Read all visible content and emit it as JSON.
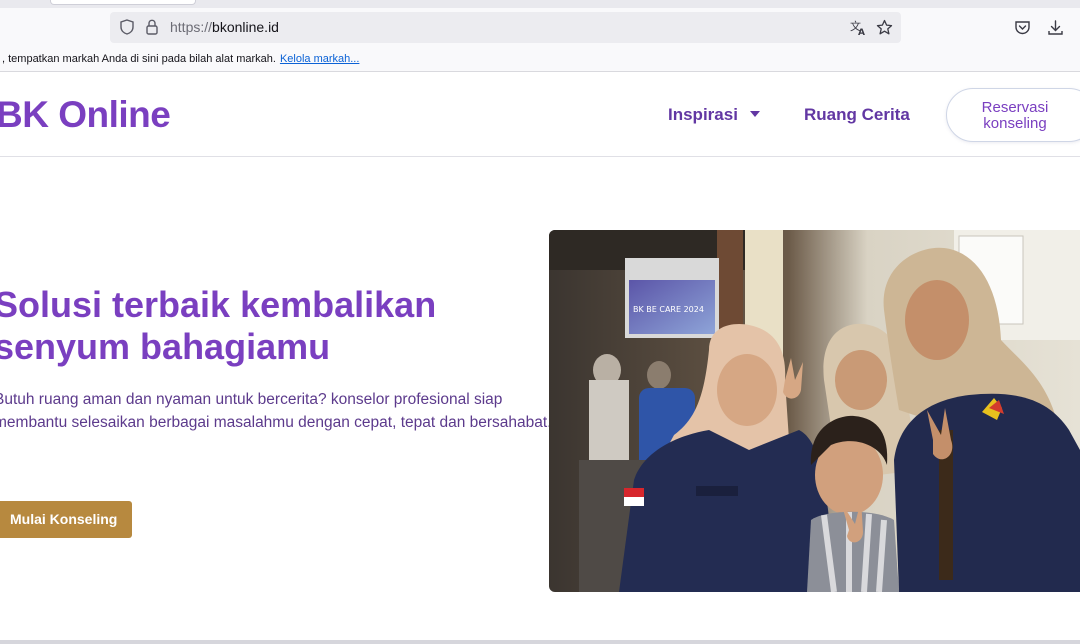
{
  "browser": {
    "url_protocol": "https://",
    "url_host": "bkonline.id",
    "bookmarks_text": ", tempatkan markah Anda di sini pada bilah alat markah.",
    "bookmarks_link": "Kelola markah...",
    "icons": [
      "shield-icon",
      "lock-icon",
      "translate-icon",
      "star-icon",
      "pocket-icon",
      "download-icon"
    ]
  },
  "site": {
    "brand": "BK Online",
    "nav": {
      "inspirasi": "Inspirasi",
      "cerita": "Ruang Cerita"
    },
    "reservasi": {
      "line1": "Reservasi",
      "line2": "konseling"
    }
  },
  "hero": {
    "title_line1": "Solusi terbaik kembalikan",
    "title_line2": "senyum bahagiamu",
    "sub_line1": "Butuh ruang aman dan nyaman untuk bercerita? konselor profesional siap",
    "sub_line2": "membantu selesaikan berbagai masalahmu dengan cepat, tepat dan bersahabat.",
    "cta": "Mulai Konseling",
    "screen_text": "BK BE CARE 2024"
  },
  "colors": {
    "brand_purple": "#7a3fc0",
    "nav_purple": "#6237a3",
    "cta_gold": "#b7893f"
  }
}
